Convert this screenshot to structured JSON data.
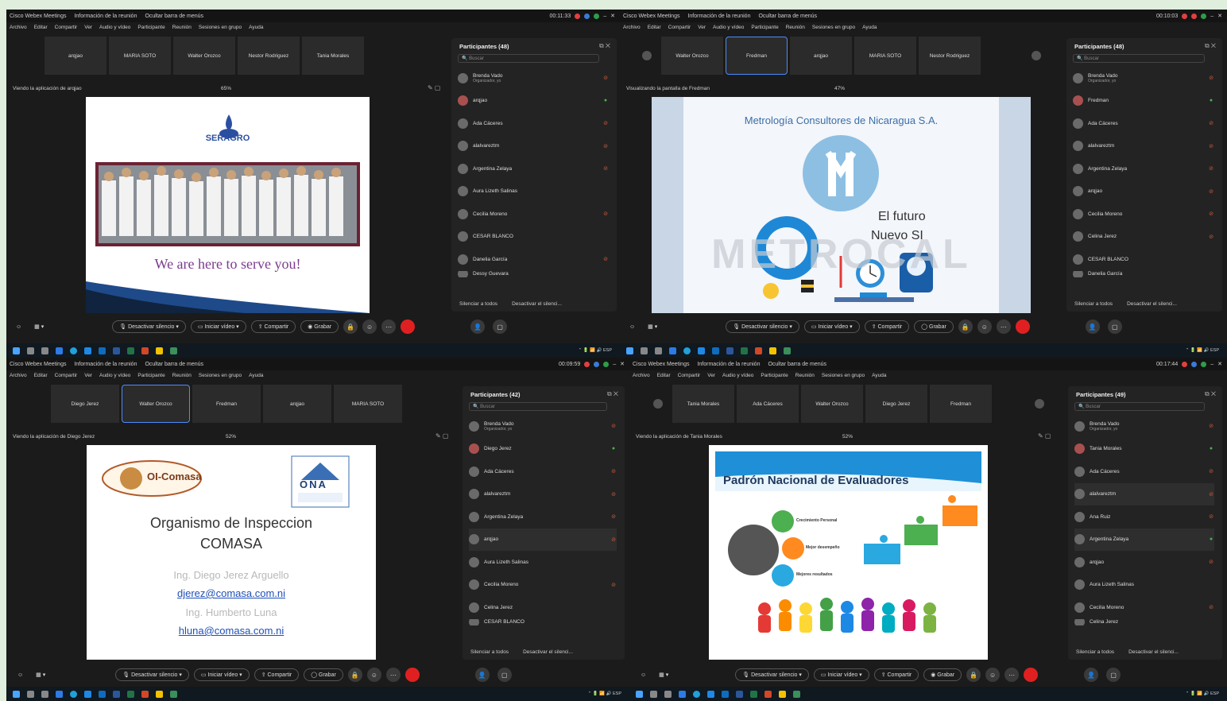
{
  "window": {
    "app_title": "Cisco Webex Meetings",
    "meeting_info": "Información de la reunión",
    "layout_menu": "Ocultar barra de menús",
    "time_q1": "00:11:33",
    "time_q2": "00:10:03",
    "time_q3": "00:09:59",
    "time_q4": "00:17:44"
  },
  "menu": [
    "Archivo",
    "Editar",
    "Compartir",
    "Ver",
    "Audio y vídeo",
    "Participante",
    "Reunión",
    "Sesiones en grupo",
    "Ayuda"
  ],
  "quads": {
    "q1": {
      "tiles": [
        "arqjao",
        "MARIA SOTO",
        "Walter Orozco",
        "Nestor Rodriguez",
        "Tania Morales"
      ],
      "viewing": "Viendo la aplicación de arqjao",
      "zoom": "65%",
      "participants_title": "Participantes (48)",
      "participants": [
        {
          "name": "Brenda Vado",
          "sub": "Organizador, yo"
        },
        {
          "name": "arqjao"
        },
        {
          "name": "Ada Cáceres"
        },
        {
          "name": "alalvareztm"
        },
        {
          "name": "Argentina Zelaya"
        },
        {
          "name": "Aura Lizeth Salinas"
        },
        {
          "name": "Cecilia Moreno"
        },
        {
          "name": "CESAR BLANCO"
        },
        {
          "name": "Danelia García"
        },
        {
          "name": "Dessy Guevara"
        }
      ],
      "slide_brand": "SERAGRO",
      "slide_tagline": "We are here to serve you!"
    },
    "q2": {
      "tiles": [
        "Walter Orozco",
        "Fredman",
        "arqjao",
        "MARIA SOTO",
        "Nestor Rodriguez"
      ],
      "viewing": "Visualizando la pantalla de Fredman",
      "zoom": "47%",
      "participants_title": "Participantes (48)",
      "participants": [
        {
          "name": "Brenda Vado",
          "sub": "Organizador, yo"
        },
        {
          "name": "Fredman"
        },
        {
          "name": "Ada Cáceres"
        },
        {
          "name": "alalvareztm"
        },
        {
          "name": "Argentina Zelaya"
        },
        {
          "name": "arqjao"
        },
        {
          "name": "Cecilia Moreno"
        },
        {
          "name": "Celina Jerez"
        },
        {
          "name": "CESAR BLANCO"
        },
        {
          "name": "Danelia García"
        }
      ],
      "slide_title": "Metrología Consultores de Nicaragua S.A.",
      "slide_line1": "El futuro",
      "slide_line2": "Nuevo SI",
      "slide_word": "METROCAL"
    },
    "q3": {
      "tiles": [
        "Diego Jerez",
        "Walter Orozco",
        "Fredman",
        "arqjao",
        "MARIA SOTO"
      ],
      "viewing": "Viendo la aplicación de Diego Jerez",
      "zoom": "52%",
      "participants_title": "Participantes (42)",
      "participants": [
        {
          "name": "Brenda Vado",
          "sub": "Organizador, yo"
        },
        {
          "name": "Diego Jerez"
        },
        {
          "name": "Ada Cáceres"
        },
        {
          "name": "alalvareztm"
        },
        {
          "name": "Argentina Zelaya"
        },
        {
          "name": "arqjao"
        },
        {
          "name": "Aura Lizeth Salinas"
        },
        {
          "name": "Cecilia Moreno"
        },
        {
          "name": "Celina Jerez"
        },
        {
          "name": "CESAR BLANCO"
        }
      ],
      "logo_left": "OI-Comasa",
      "logo_right": "ONA",
      "slide_title1": "Organismo de Inspeccion",
      "slide_title2": "COMASA",
      "person1": "Ing. Diego Jerez Arguello",
      "email1": "djerez@comasa.com.ni",
      "person2": "Ing. Humberto Luna",
      "email2": "hluna@comasa.com.ni"
    },
    "q4": {
      "tiles": [
        "Tania Morales",
        "Ada Cáceres",
        "Walter Orozco",
        "Diego Jerez",
        "Fredman"
      ],
      "viewing": "Viendo la aplicación de Tania Morales",
      "zoom": "52%",
      "participants_title": "Participantes (49)",
      "participants": [
        {
          "name": "Brenda Vado",
          "sub": "Organizador, yo"
        },
        {
          "name": "Tania Morales"
        },
        {
          "name": "Ada Cáceres"
        },
        {
          "name": "alalvareztm"
        },
        {
          "name": "Ana Ruiz"
        },
        {
          "name": "Argentina Zelaya"
        },
        {
          "name": "arqjao"
        },
        {
          "name": "Aura Lizeth Salinas"
        },
        {
          "name": "Cecilia Moreno"
        },
        {
          "name": "Celina Jerez"
        }
      ],
      "slide_title": "Padrón Nacional de Evaluadores",
      "item1": "Crecimiento Personal",
      "item2": "Mejor desempeño",
      "item3": "Mejores resultados"
    }
  },
  "panel_footer": {
    "mute_all": "Silenciar a todos",
    "unmute_all": "Desactivar el silenci..."
  },
  "controls": {
    "mute": "Desactivar silencio",
    "video": "Iniciar vídeo",
    "share": "Compartir",
    "record": "Grabar"
  },
  "colors": {
    "end_call": "#e02020",
    "accent": "#4a8cff",
    "taskbar": "#101820"
  }
}
